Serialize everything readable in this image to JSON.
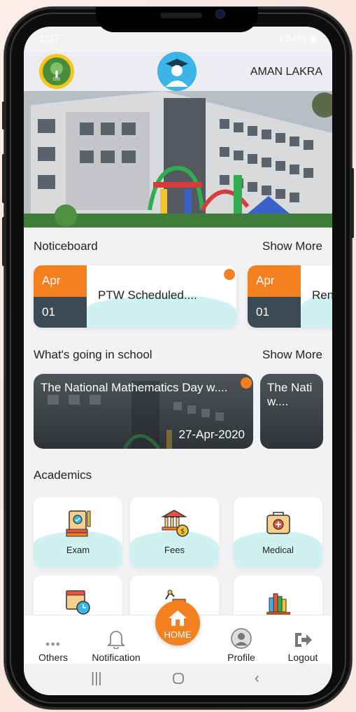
{
  "status": {
    "time": "1:37",
    "battery": "84%"
  },
  "header": {
    "user_name": "AMAN LAKRA"
  },
  "noticeboard": {
    "title": "Noticeboard",
    "show_more": "Show More",
    "items": [
      {
        "month": "Apr",
        "day": "01",
        "title": "PTW Scheduled....",
        "unread": true
      },
      {
        "month": "Apr",
        "day": "01",
        "title": "Ren",
        "unread": false
      }
    ]
  },
  "events": {
    "title": "What's going in school",
    "show_more": "Show More",
    "items": [
      {
        "title": "The National Mathematics Day w....",
        "date": "27-Apr-2020",
        "unread": true
      },
      {
        "title": "The Nati w....",
        "date": "",
        "unread": false
      }
    ]
  },
  "academics": {
    "title": "Academics",
    "tiles": [
      {
        "label": "Exam",
        "icon": "exam-icon"
      },
      {
        "label": "Fees",
        "icon": "fees-icon"
      },
      {
        "label": "Medical",
        "icon": "medical-icon"
      },
      {
        "label": "",
        "icon": "timetable-icon"
      },
      {
        "label": "",
        "icon": "homework-icon"
      },
      {
        "label": "",
        "icon": "library-icon"
      }
    ]
  },
  "bottom_nav": {
    "others": "Others",
    "notification": "Notification",
    "home": "HOME",
    "profile": "Profile",
    "logout": "Logout"
  },
  "colors": {
    "accent": "#f48120",
    "dark": "#3b4a54",
    "wave": "#cff1f2"
  }
}
